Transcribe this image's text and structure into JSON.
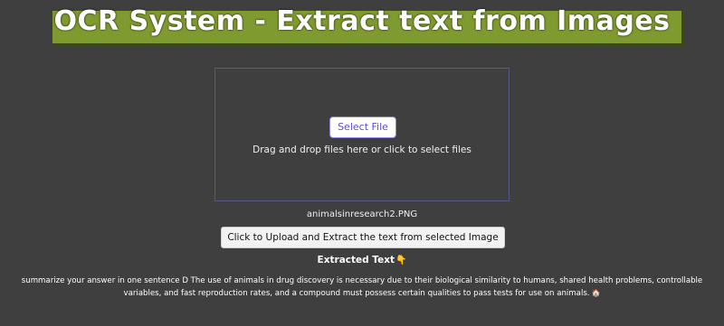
{
  "header": {
    "title": "OCR System - Extract text from Images"
  },
  "dropzone": {
    "select_button_label": "Select File",
    "hint": "Drag and drop files here or click to select files"
  },
  "file": {
    "name": "animalsinresearch2.PNG"
  },
  "upload": {
    "button_label": "Click to Upload and Extract the text from selected Image"
  },
  "result": {
    "heading": "Extracted Text",
    "heading_icon": "pointing-down-icon",
    "text": "summarize your answer in one sentence D The use of animals in drug discovery is necessary due to their biological similarity to humans, shared health problems, controllable variables, and fast reproduction rates, and a compound must possess certain qualities to pass tests for use on animals.",
    "trailing_icon": "house-icon"
  },
  "colors": {
    "background": "#3f3f3f",
    "title_highlight": "#7f9a2e",
    "dropzone_border": "#5a5a8a",
    "select_button_text": "#5a4fd0"
  }
}
